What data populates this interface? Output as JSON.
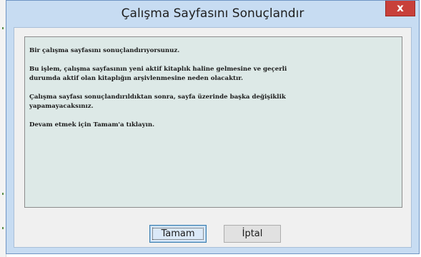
{
  "dialog": {
    "title": "Çalışma Sayfasını Sonuçlandır",
    "close_icon": "✖",
    "close_glyph": "x"
  },
  "message": {
    "paragraphs": [
      [
        "Bir çalışma sayfasını sonuçlandırıyorsunuz."
      ],
      [
        "Bu işlem, çalışma sayfasının yeni aktif kitaplık haline gelmesine ve geçerli",
        "durumda aktif olan kitaplığın arşivlenmesine neden olacaktır."
      ],
      [
        "Çalışma sayfası sonuçlandırıldıktan sonra, sayfa üzerinde başka değişiklik",
        "yapamayacaksınız."
      ],
      [
        "Devam etmek için Tamam'a tıklayın."
      ]
    ]
  },
  "buttons": {
    "ok_label": "Tamam",
    "cancel_label": "İptal"
  },
  "colors": {
    "title_bar": "#c7dcf2",
    "close_button": "#c8403a",
    "message_background": "#dde9e7"
  }
}
